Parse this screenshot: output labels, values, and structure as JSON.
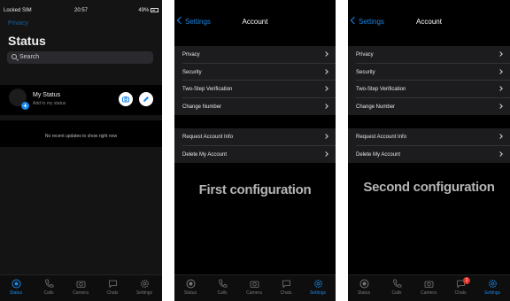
{
  "panel1": {
    "statusbar": {
      "carrier": "Locked SIM",
      "time": "20:57",
      "battery": "49%"
    },
    "privacy_link": "Privacy",
    "title": "Status",
    "search_placeholder": "Search",
    "my_status": {
      "name": "My Status",
      "subtitle": "Add to my status"
    },
    "no_updates": "No recent updates to show right now",
    "tabs": [
      {
        "label": "Status",
        "icon": "status-icon"
      },
      {
        "label": "Calls",
        "icon": "phone-icon"
      },
      {
        "label": "Camera",
        "icon": "camera-icon"
      },
      {
        "label": "Chats",
        "icon": "chat-icon"
      },
      {
        "label": "Settings",
        "icon": "gear-icon"
      }
    ]
  },
  "panel2": {
    "back_label": "Settings",
    "title": "Account",
    "group1": [
      "Privacy",
      "Security",
      "Two-Step Verification",
      "Change Number"
    ],
    "group2": [
      "Request Account Info",
      "Delete My Account"
    ],
    "overlay": "First configuration",
    "tabs": [
      "Status",
      "Calls",
      "Camera",
      "Chats",
      "Settings"
    ]
  },
  "panel3": {
    "back_label": "Settings",
    "title": "Account",
    "group1": [
      "Privacy",
      "Security",
      "Two-Step Verification",
      "Change Number"
    ],
    "group2": [
      "Request Account Info",
      "Delete My Account"
    ],
    "overlay": "Second configuration",
    "tabs": [
      "Status",
      "Calls",
      "Camera",
      "Chats",
      "Settings"
    ],
    "chats_badge": "1"
  },
  "colors": {
    "accent": "#1a86e6",
    "badge": "#e0342b",
    "background": "#000000"
  }
}
